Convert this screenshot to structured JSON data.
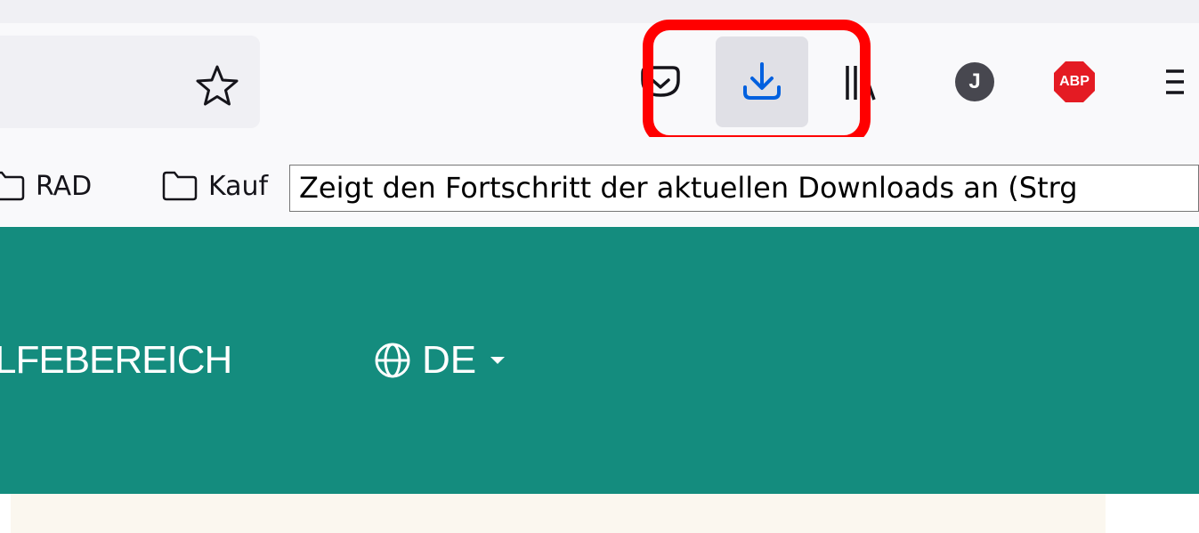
{
  "toolbar": {
    "downloads_tooltip": "Zeigt den Fortschritt der aktuellen Downloads an (Strg",
    "icons": [
      "star-icon",
      "pocket-icon",
      "download-icon",
      "library-icon",
      "account-icon",
      "adblock-icon",
      "menu-icon"
    ],
    "account_initial": "J",
    "adblock_label": "ABP"
  },
  "bookmarks": {
    "items": [
      {
        "label": "RAD"
      },
      {
        "label": "Kauf"
      }
    ]
  },
  "site": {
    "nav_partial": "LFEBEREICH",
    "language": "DE"
  },
  "colors": {
    "header_green": "#148c7e",
    "highlight_red": "#ff0000",
    "download_blue": "#0060df",
    "adblock_red": "#e41b23"
  }
}
